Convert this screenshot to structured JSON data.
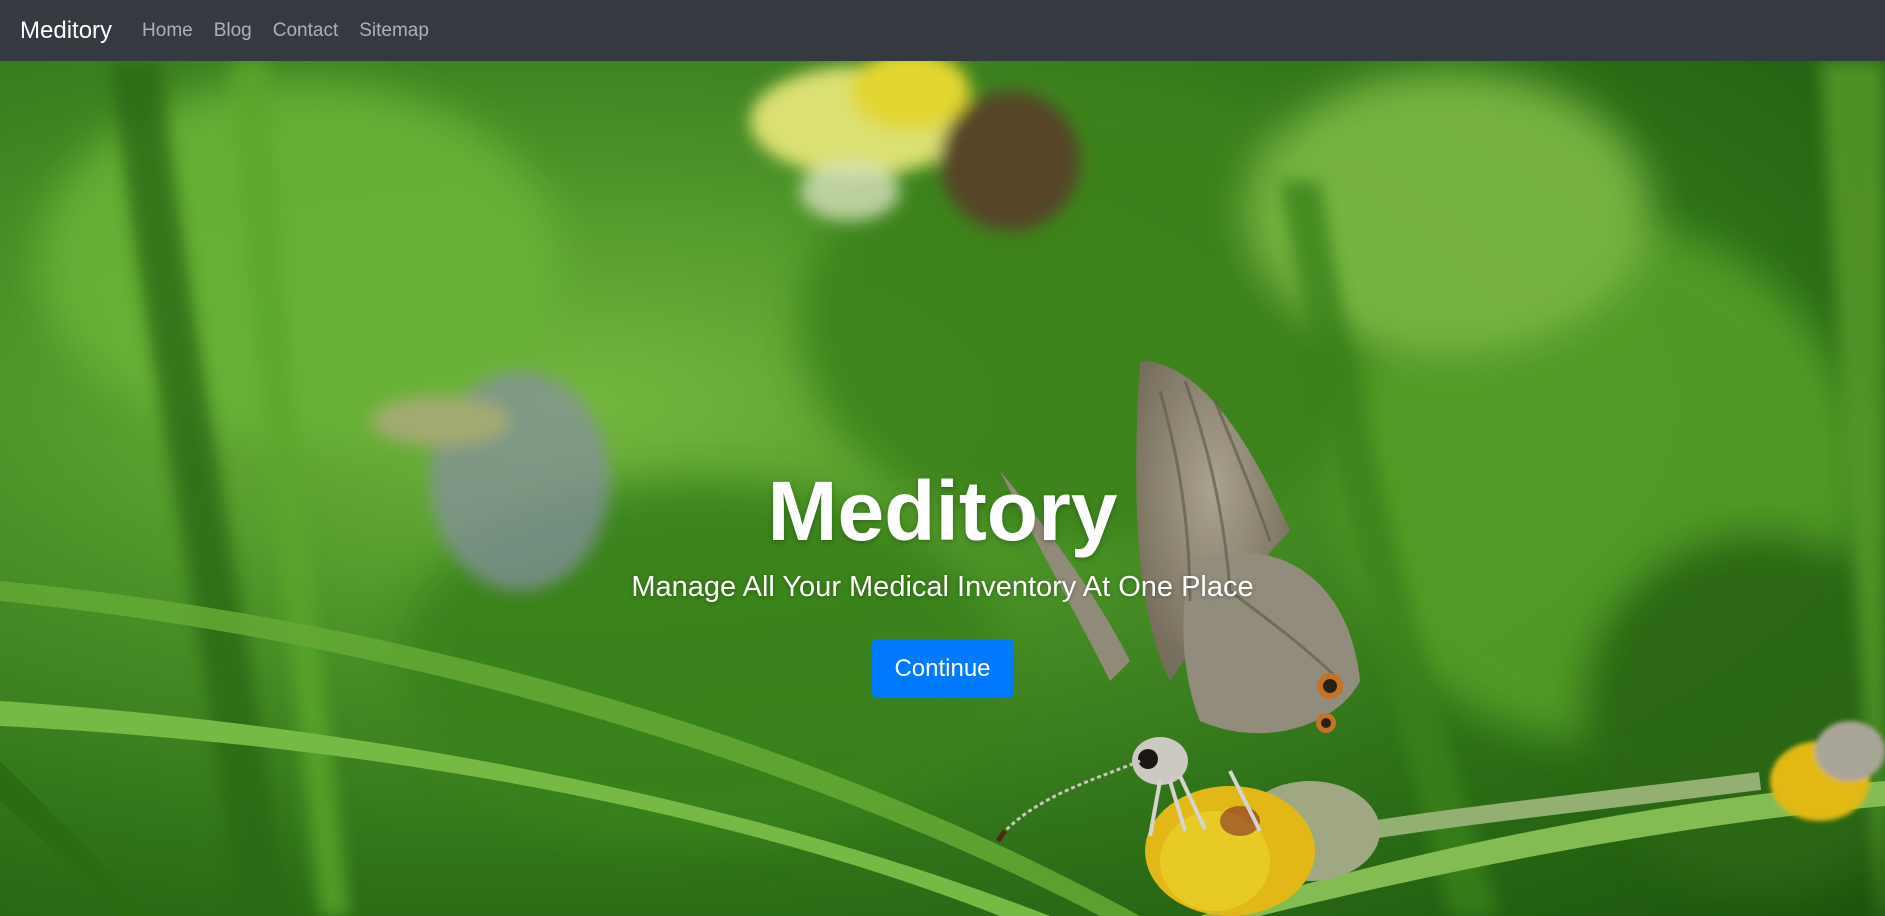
{
  "navbar": {
    "brand": "Meditory",
    "links": [
      "Home",
      "Blog",
      "Contact",
      "Sitemap"
    ]
  },
  "hero": {
    "title": "Meditory",
    "subtitle": "Manage All Your Medical Inventory At One Place",
    "button_label": "Continue",
    "background_subject": "butterfly-on-yellow-flower-in-grass"
  },
  "colors": {
    "navbar_bg": "#343a40",
    "nav_link": "rgba(255,255,255,0.6)",
    "brand_text": "#ffffff",
    "button_bg": "#007bff",
    "grass_green": "#4f9a2a"
  }
}
